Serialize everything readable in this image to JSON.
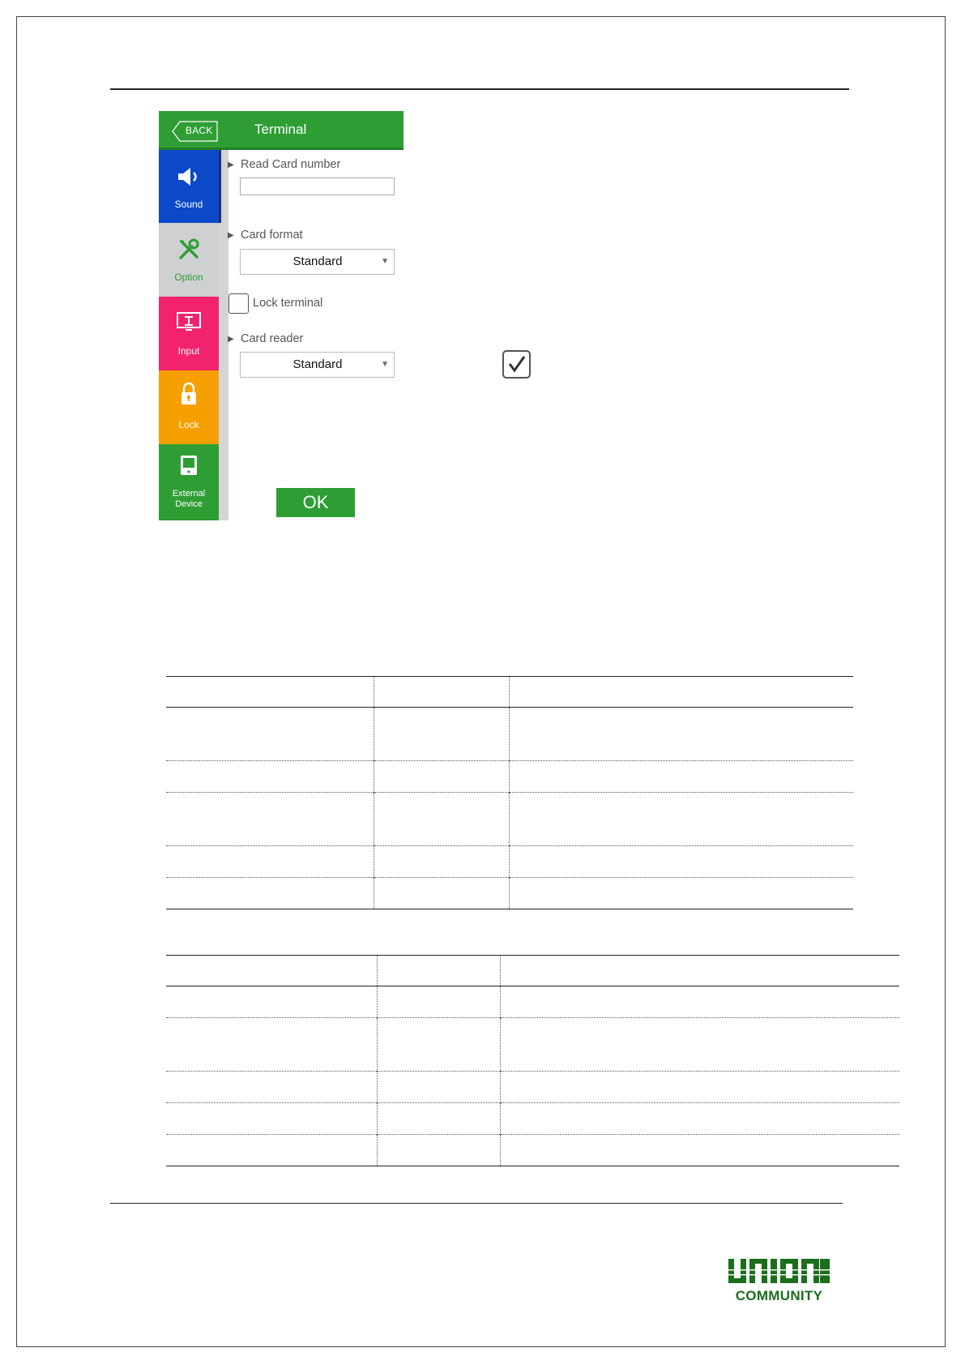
{
  "device": {
    "back_label": "BACK",
    "title": "Terminal",
    "tabs": [
      {
        "label": "Sound",
        "icon": "speaker-icon"
      },
      {
        "label": "Option",
        "icon": "tools-icon"
      },
      {
        "label": "Input",
        "icon": "input-monitor-icon"
      },
      {
        "label": "Lock",
        "icon": "padlock-icon"
      },
      {
        "label_line1": "External",
        "label_line2": "Device",
        "icon": "external-device-icon"
      }
    ],
    "read_card_number": {
      "label": "Read Card number",
      "value": ""
    },
    "card_format": {
      "label": "Card format",
      "value": "Standard"
    },
    "lock_terminal": {
      "label": "Lock terminal",
      "checked": false
    },
    "card_reader": {
      "label": "Card reader",
      "value": "Standard"
    },
    "ok_label": "OK"
  },
  "side_checkbox": {
    "checked": true
  },
  "logo": {
    "top_text": "UNION",
    "bottom_text": "COMMUNITY"
  },
  "colors": {
    "header_green": "#2e9e34",
    "sound_blue": "#0b49c8",
    "option_gray": "#cfd0d2",
    "option_text_green": "#2e9e34",
    "input_pink": "#f2226f",
    "lock_orange": "#f5a000",
    "logo_green": "#1c6e1c"
  }
}
